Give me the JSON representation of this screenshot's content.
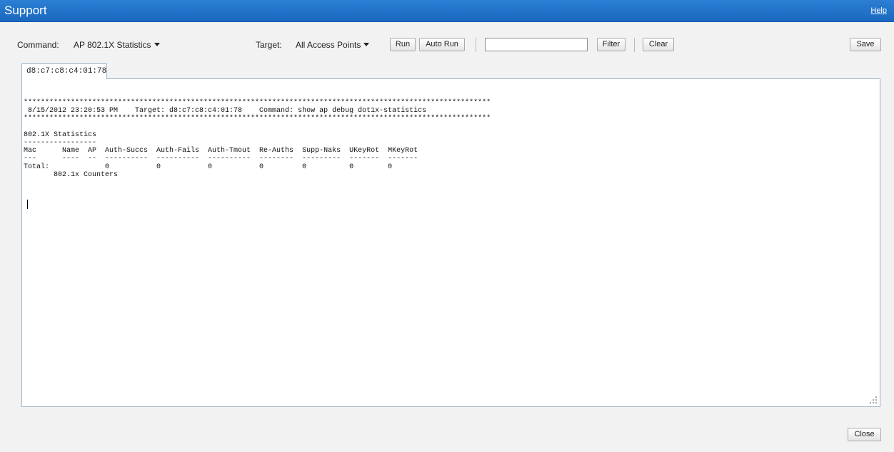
{
  "window": {
    "title": "Support",
    "help_label": "Help"
  },
  "toolbar": {
    "command_label": "Command:",
    "command_value": "AP 802.1X Statistics",
    "target_label": "Target:",
    "target_value": "All Access Points",
    "run_label": "Run",
    "auto_run_label": "Auto Run",
    "filter_value": "",
    "filter_label": "Filter",
    "clear_label": "Clear",
    "save_label": "Save"
  },
  "tabs": [
    {
      "label": "d8:c7:c8:c4:01:78"
    }
  ],
  "output": {
    "text": "*************************************************************************************************************\n 8/15/2012 23:20:53 PM    Target: d8:c7:c8:c4:01:78    Command: show ap debug dot1x-statistics\n*************************************************************************************************************\n\n802.1X Statistics\n-----------------\nMac      Name  AP  Auth-Succs  Auth-Fails  Auth-Tmout  Re-Auths  Supp-Naks  UKeyRot  MKeyRot\n---      ----  --  ----------  ----------  ----------  --------  ---------  -------  -------\nTotal:             0           0           0           0         0          0        0\n       802.1x Counters"
  },
  "footer": {
    "close_label": "Close"
  }
}
